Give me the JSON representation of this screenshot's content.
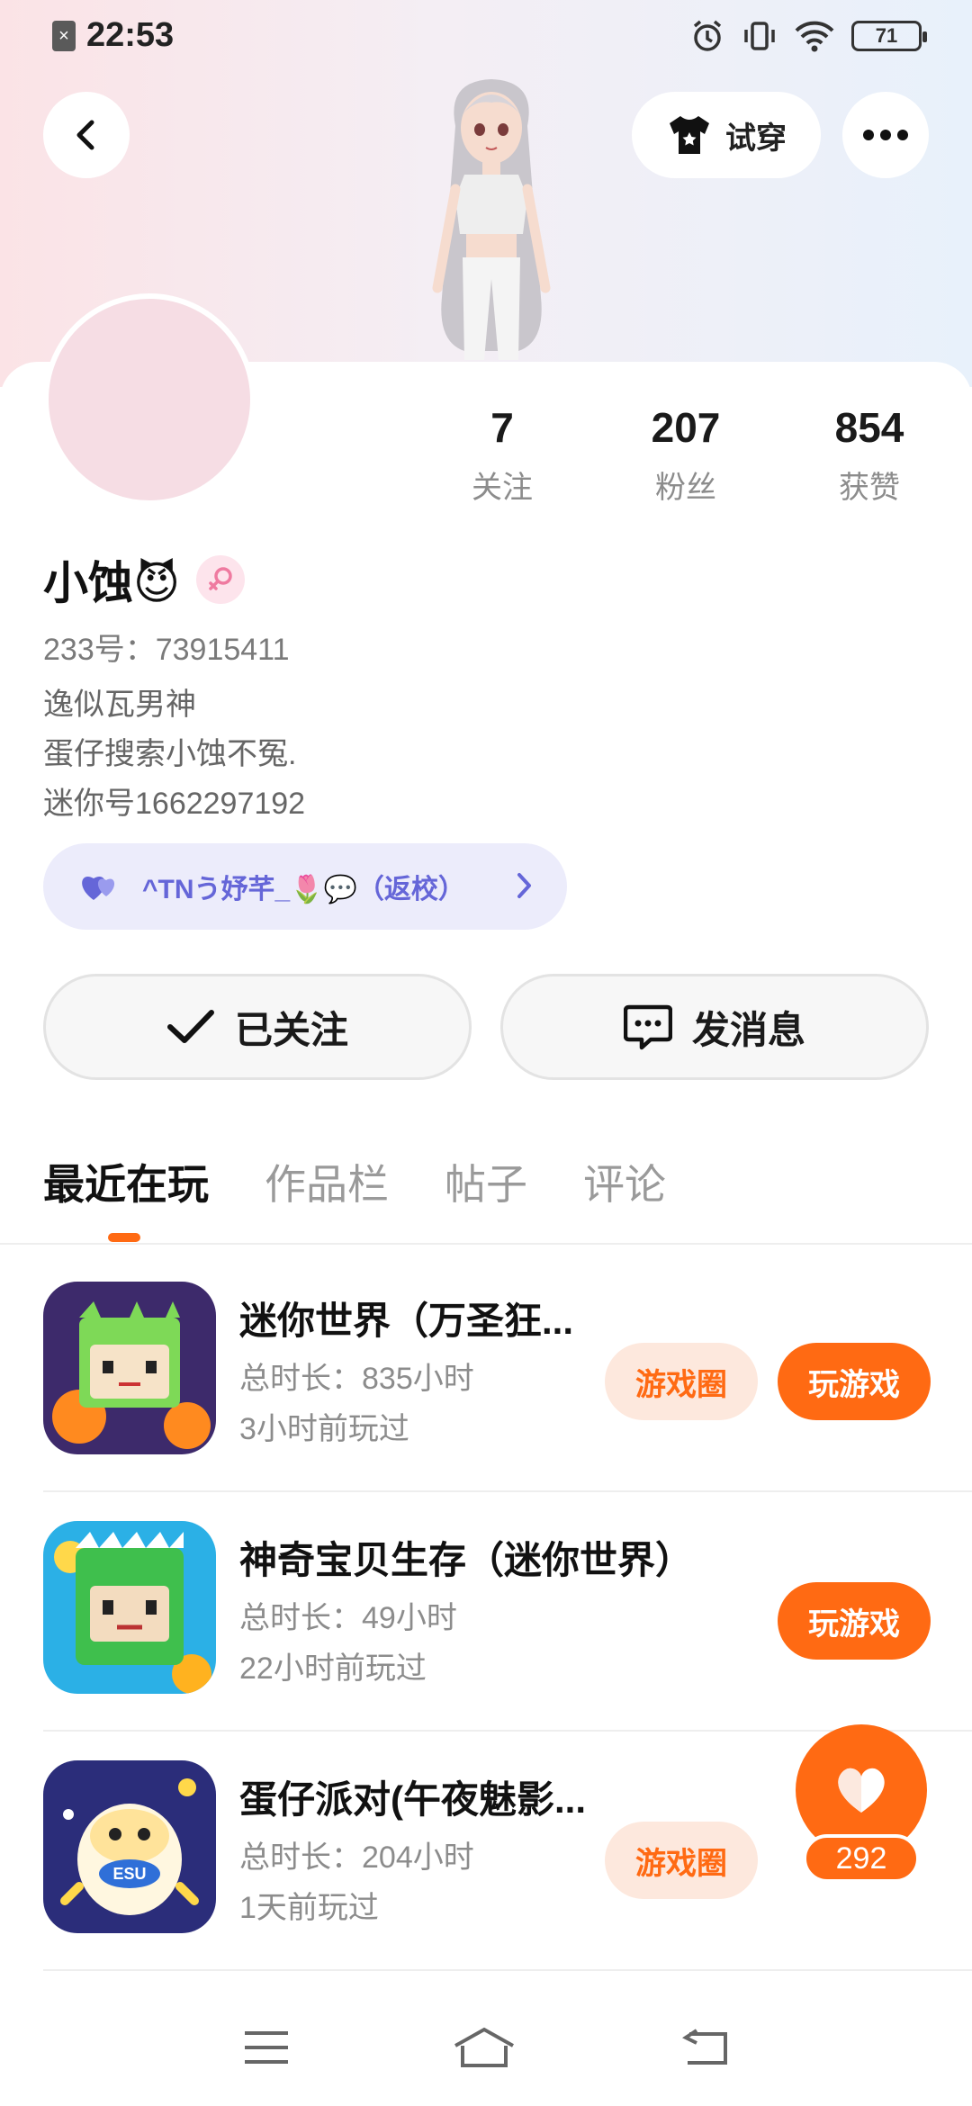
{
  "status_bar": {
    "time": "22:53",
    "battery": "71"
  },
  "header": {
    "tryon_label": "试穿"
  },
  "stats": [
    {
      "value": "7",
      "label": "关注"
    },
    {
      "value": "207",
      "label": "粉丝"
    },
    {
      "value": "854",
      "label": "获赞"
    }
  ],
  "profile": {
    "name": "小蚀😈",
    "uid": "233号：73915411",
    "bio": [
      "逸似瓦男神",
      "蛋仔搜索小蚀不冤.",
      "迷你号1662297192"
    ],
    "group": "^TNう妤芊_🌷💬（返校）"
  },
  "actions": {
    "follow_label": "已关注",
    "message_label": "发消息"
  },
  "tabs": [
    "最近在玩",
    "作品栏",
    "帖子",
    "评论"
  ],
  "games": [
    {
      "title": "迷你世界（万圣狂...",
      "duration": "总时长：835小时",
      "last_played": "3小时前玩过",
      "circle_label": "游戏圈",
      "play_label": "玩游戏"
    },
    {
      "title": "神奇宝贝生存（迷你世界）",
      "duration": "总时长：49小时",
      "last_played": "22小时前玩过",
      "play_label": "玩游戏"
    },
    {
      "title": "蛋仔派对(午夜魅影...",
      "duration": "总时长：204小时",
      "last_played": "1天前玩过",
      "circle_label": "游戏圈"
    }
  ],
  "like_fab": {
    "count": "292"
  },
  "colors": {
    "accent": "#ff6a13",
    "accent_light": "#fde8dd",
    "group_text": "#6566d8",
    "group_bg": "#ececfb"
  }
}
